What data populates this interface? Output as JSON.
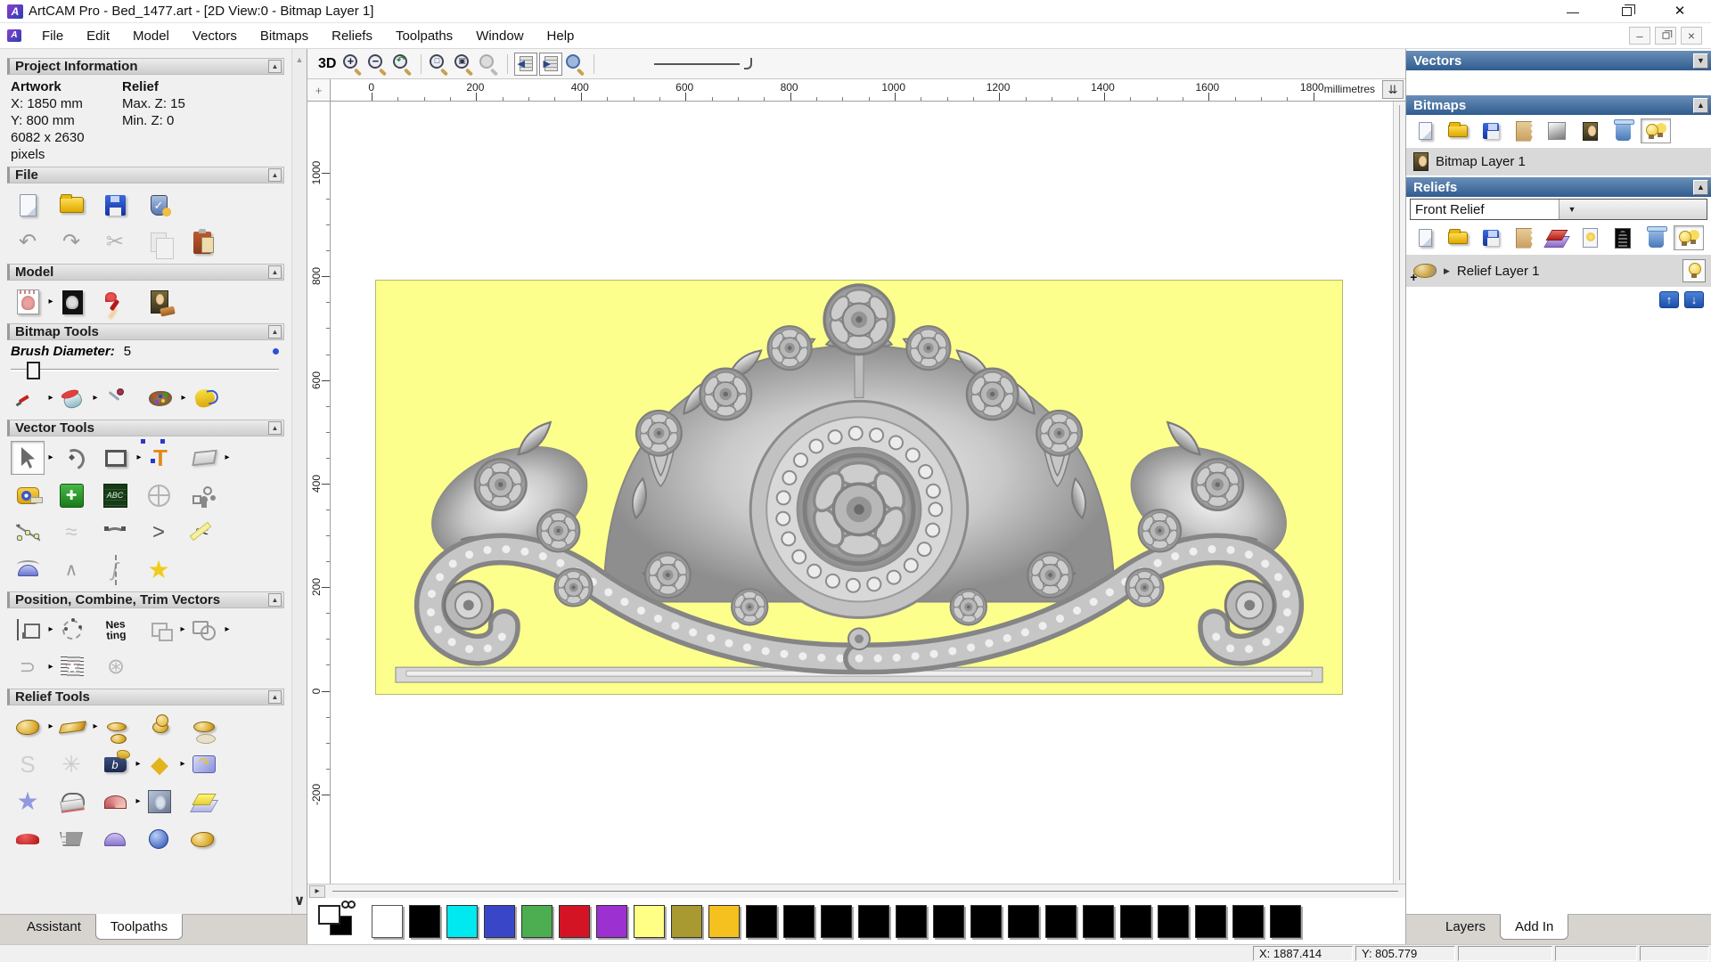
{
  "window": {
    "title": "ArtCAM Pro - Bed_1477.art - [2D View:0 - Bitmap Layer 1]"
  },
  "menu": {
    "items": [
      "File",
      "Edit",
      "Model",
      "Vectors",
      "Bitmaps",
      "Reliefs",
      "Toolpaths",
      "Window",
      "Help"
    ]
  },
  "assistant": {
    "project_information": {
      "title": "Project Information",
      "artwork_label": "Artwork",
      "x": "X: 1850 mm",
      "y": "Y: 800 mm",
      "pixels": "6082 x 2630 pixels",
      "relief_label": "Relief",
      "max_z": "Max. Z: 15",
      "min_z": "Min. Z: 0"
    },
    "file_title": "File",
    "model_title": "Model",
    "bitmap_tools_title": "Bitmap Tools",
    "brush_diameter_label": "Brush Diameter:",
    "brush_diameter_value": "5",
    "vector_tools_title": "Vector Tools",
    "position_title": "Position, Combine, Trim Vectors",
    "relief_tools_title": "Relief Tools",
    "tabs": {
      "assistant": "Assistant",
      "toolpaths": "Toolpaths"
    }
  },
  "toolbar": {
    "view3d": "3D"
  },
  "ruler": {
    "h_ticks": [
      "0",
      "200",
      "400",
      "600",
      "800",
      "1000",
      "1200",
      "1400",
      "1600",
      "1800"
    ],
    "v_ticks": [
      "1000",
      "800",
      "600",
      "400",
      "200",
      "0",
      "-200"
    ],
    "units": "millimetres"
  },
  "panels": {
    "vectors_title": "Vectors",
    "bitmaps_title": "Bitmaps",
    "bitmap_layer": "Bitmap Layer 1",
    "reliefs_title": "Reliefs",
    "relief_select": "Front Relief",
    "relief_layer": "Relief Layer 1",
    "tabs": {
      "layers": "Layers",
      "addin": "Add In"
    }
  },
  "palette": {
    "colors": [
      "#ffffff",
      "#000000",
      "#00e8f0",
      "#3a46c8",
      "#4cae50",
      "#d41424",
      "#9c30d0",
      "#ffff86",
      "#a89a30",
      "#f4c11e",
      "#000000",
      "#000000",
      "#000000",
      "#000000",
      "#000000",
      "#000000",
      "#000000",
      "#000000",
      "#000000",
      "#000000",
      "#000000",
      "#000000",
      "#000000",
      "#000000",
      "#000000"
    ]
  },
  "status": {
    "x": "X: 1887.414",
    "y": "Y: 805.779"
  },
  "layout": {
    "h_tick_start": 46,
    "h_tick_pitch": 117.4,
    "v_tick_start": 80,
    "v_tick_pitch": 116.3
  },
  "icons": {
    "flyout": {
      "g": "▸",
      "c": "#000",
      "s": 10
    },
    "panel-collapse": {
      "g": "▲",
      "c": "#444",
      "s": 8
    },
    "vectors-collapse": {
      "g": "▼",
      "c": "#222",
      "s": 9
    },
    "bitmaps-collapse": {
      "g": "▲",
      "c": "#222",
      "s": 9
    },
    "reliefs-collapse": {
      "g": "▲",
      "c": "#222",
      "s": 9
    },
    "scroll-up": {
      "g": "▲",
      "c": "#999",
      "s": 9
    },
    "scroll-down": {
      "g": "∨",
      "c": "#333",
      "s": 16
    },
    "units-dropdown": {
      "g": "⇊",
      "c": "#333",
      "s": 13
    },
    "corner-cross": {
      "g": "+",
      "c": "#777",
      "s": 13
    },
    "splitter-arrow": {
      "g": "▸",
      "c": "#333",
      "s": 10
    },
    "undo": {
      "g": "↶",
      "c": "#9a9a9a",
      "s": 24
    },
    "redo": {
      "g": "↷",
      "c": "#9a9a9a",
      "s": 24
    },
    "cut": {
      "g": "✂",
      "c": "#b4b4b4",
      "s": 24
    },
    "zoom-in-sign": {
      "g": "+",
      "c": "#223",
      "s": 13
    },
    "zoom-out-sign": {
      "g": "−",
      "c": "#223",
      "s": 13
    },
    "zoom-last-sign": {
      "g": "↶",
      "c": "#1f8a1f",
      "s": 11
    },
    "zoom-box-sign": {
      "g": "□",
      "c": "#334",
      "s": 9
    },
    "zoom-fit-sign": {
      "g": "▣",
      "c": "#334",
      "s": 9
    },
    "toggle-left": {
      "g": "◀",
      "c": "#2a4a8a",
      "s": 11
    },
    "toggle-right": {
      "g": "▶",
      "c": "#2a4a8a",
      "s": 11
    },
    "check": {
      "g": "✓",
      "c": "#ffffff",
      "s": 13
    },
    "plus-white": {
      "g": "✚",
      "c": "#eaffea",
      "s": 15
    },
    "text-T": {
      "g": "T",
      "c": "#e08a1a",
      "s": 26
    },
    "abc": {
      "g": "ABC",
      "c": "#d6ecd6",
      "s": 9
    },
    "nesting": {
      "g": "Nes\nting",
      "c": "#111",
      "s": 12
    },
    "s-tool": {
      "g": "S",
      "c": "#cfcfcf",
      "s": 26
    },
    "weave": {
      "g": "✳",
      "c": "#cccccc",
      "s": 26
    },
    "book-b": {
      "g": "b",
      "c": "#ffffff",
      "s": 13
    },
    "diamond-gold": {
      "g": "◆",
      "c": "#e2b41e",
      "s": 26
    },
    "wrap-arrow": {
      "g": "↷",
      "c": "#edc41e",
      "s": 15
    },
    "star-yellow": {
      "g": "★",
      "c": "#f0cc1c",
      "s": 28
    },
    "star-blue": {
      "g": "★",
      "c": "#9098e0",
      "s": 28
    },
    "sketch": {
      "g": "≈",
      "c": "#c8c8c8",
      "s": 24
    },
    "fillet": {
      "g": ">",
      "c": "#555",
      "s": 24
    },
    "join": {
      "g": "⊃",
      "c": "#a8a8a8",
      "s": 22
    },
    "spiral": {
      "g": "⊛",
      "c": "#b4b4b4",
      "s": 24
    },
    "mirror": {
      "g": "ʃ",
      "c": "#aaa",
      "s": 22
    },
    "nodes": {
      "g": "∧",
      "c": "#9a9a9a",
      "s": 20
    },
    "trim-scissors": {
      "g": "✂",
      "c": "#222",
      "s": 18
    },
    "up-arrow": {
      "g": "↑",
      "c": "#fff",
      "s": 13
    },
    "down-arrow": {
      "g": "↓",
      "c": "#fff",
      "s": 13
    },
    "expand-right": {
      "g": "▶",
      "c": "#333",
      "s": 9
    },
    "mdi-min": {
      "g": "–",
      "c": "#555",
      "s": 13
    },
    "mdi-close": {
      "g": "×",
      "c": "#555",
      "s": 14
    },
    "title-min": {
      "g": "—",
      "c": "#111",
      "s": 14
    },
    "title-close": {
      "g": "✕",
      "c": "#111",
      "s": 15
    }
  }
}
